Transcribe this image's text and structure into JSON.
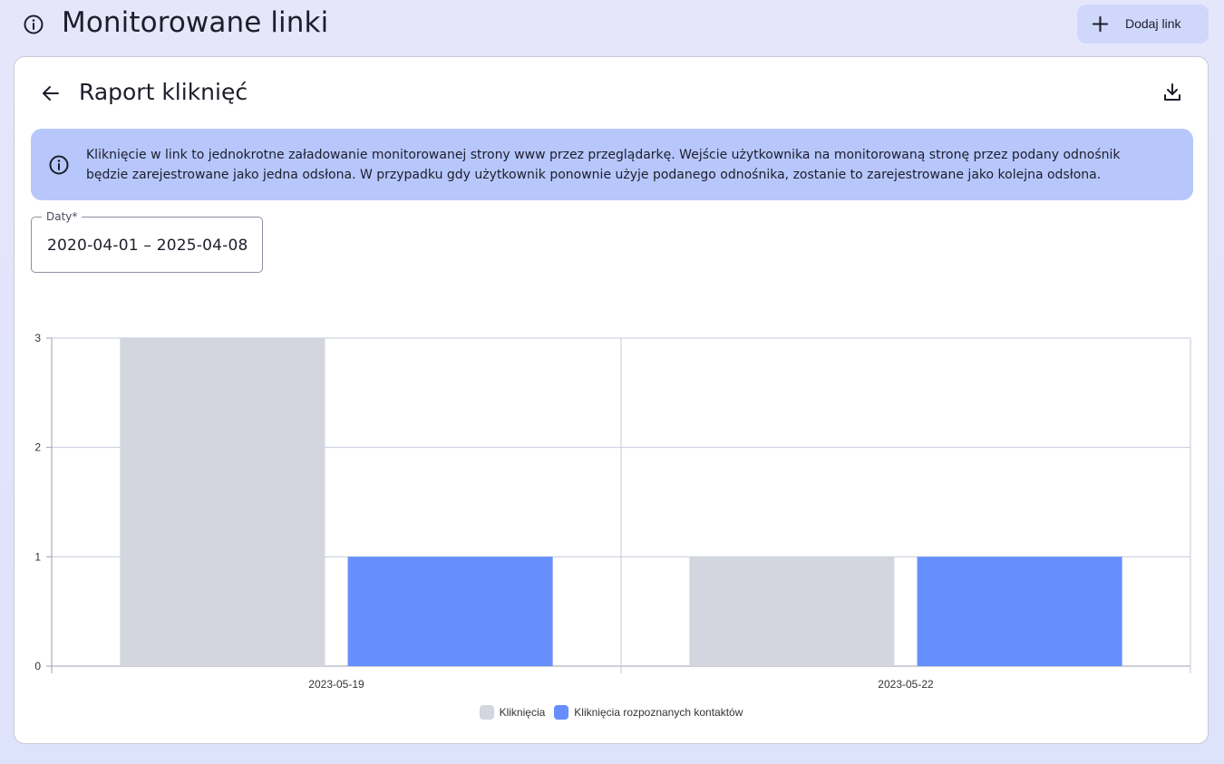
{
  "header": {
    "title": "Monitorowane linki",
    "add_button_label": "Dodaj link"
  },
  "card": {
    "title": "Raport kliknięć",
    "info_text": "Kliknięcie w link to jednokrotne załadowanie monitorowanej strony www przez przeglądarkę. Wejście użytkownika na monitorowaną stronę przez podany odnośnik będzie zarejestrowane jako jedna odsłona. W przypadku gdy użytkownik ponownie użyje podanego odnośnika, zostanie to zarejestrowane jako kolejna odsłona.",
    "date_field": {
      "label": "Daty*",
      "value": "2020-04-01 – 2025-04-08"
    }
  },
  "colors": {
    "series_1": "#d3d6df",
    "series_2": "#668ffd",
    "alert_bg": "#b7c7fb",
    "button_bg": "#cfd7fb"
  },
  "chart_data": {
    "type": "bar",
    "categories": [
      "2023-05-19",
      "2023-05-22"
    ],
    "series": [
      {
        "name": "Kliknięcia",
        "values": [
          3,
          1
        ]
      },
      {
        "name": "Kliknięcia rozpoznanych kontaktów",
        "values": [
          1,
          1
        ]
      }
    ],
    "yticks": [
      "0",
      "1",
      "2",
      "3"
    ],
    "ylim": [
      0,
      3
    ],
    "grid": true,
    "legend_position": "bottom"
  }
}
